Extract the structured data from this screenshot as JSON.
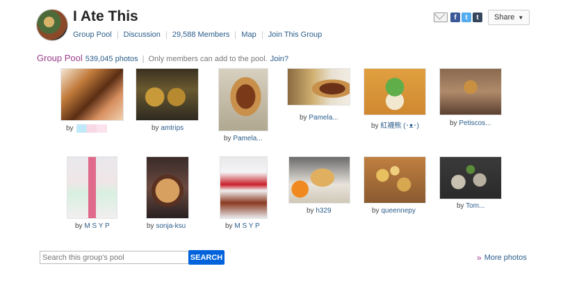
{
  "group": {
    "title": "I Ate This",
    "nav": [
      "Group Pool",
      "Discussion",
      "29,588 Members",
      "Map",
      "Join This Group"
    ]
  },
  "share": {
    "label": "Share",
    "icons": [
      "mail-icon",
      "facebook-icon",
      "twitter-icon",
      "tumblr-icon"
    ]
  },
  "pool": {
    "heading": "Group Pool",
    "count": "539,045 photos",
    "separator": "|",
    "notice": "Only members can add to the pool.",
    "join_link": "Join?"
  },
  "photos": [
    {
      "by": "by",
      "author": ""
    },
    {
      "by": "by",
      "author": "amtrips"
    },
    {
      "by": "by",
      "author": "Pamela..."
    },
    {
      "by": "by",
      "author": "Pamela..."
    },
    {
      "by": "by",
      "author": "紅襪熊 (･ᴥ･)"
    },
    {
      "by": "by",
      "author": "Petiscos..."
    },
    {
      "by": "by",
      "author": "M S Y P"
    },
    {
      "by": "by",
      "author": "sonja-ksu"
    },
    {
      "by": "by",
      "author": "M S Y P"
    },
    {
      "by": "by",
      "author": "h329"
    },
    {
      "by": "by",
      "author": "queennepy"
    },
    {
      "by": "by",
      "author": "Tom..."
    }
  ],
  "search": {
    "placeholder": "Search this group's pool",
    "button": "SEARCH"
  },
  "more": {
    "arrow": "»",
    "label": "More photos"
  }
}
